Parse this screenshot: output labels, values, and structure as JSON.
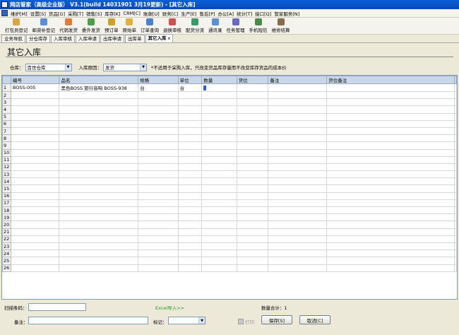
{
  "window": {
    "title": "网店管家（高级企业版） V3.1(build 14031901 3月19更新) - [其它入库]"
  },
  "menu": [
    "维护[M]",
    "设置[S]",
    "货品[G]",
    "采购[T]",
    "销售[S]",
    "库存[K]",
    "CRM[C]",
    "账款[U]",
    "财务[C]",
    "生产[E]",
    "售后[P]",
    "办公[A]",
    "统计[T]",
    "接口[Q]",
    "管家服务[N]"
  ],
  "toolbar": [
    {
      "label": "打包员登记",
      "color": "#d9a441"
    },
    {
      "label": "邮资补登记",
      "color": "#5a8fd6"
    },
    {
      "label": "代销发货",
      "color": "#e07b39"
    },
    {
      "label": "委外发货",
      "color": "#4aa04a"
    },
    {
      "label": "预订单",
      "color": "#c9a227"
    },
    {
      "label": "原始单",
      "color": "#e0b040"
    },
    {
      "label": "订单查询",
      "color": "#4f7fd0"
    },
    {
      "label": "退换审核",
      "color": "#d05050"
    },
    {
      "label": "配货分流",
      "color": "#3a9a6a"
    },
    {
      "label": "通讯录",
      "color": "#5a8fd6"
    },
    {
      "label": "任务管理",
      "color": "#6a6ac0"
    },
    {
      "label": "手机短信",
      "color": "#4a8a4a"
    },
    {
      "label": "维修结算",
      "color": "#8a6a4a"
    }
  ],
  "tabs": [
    {
      "label": "业务导航",
      "active": false
    },
    {
      "label": "分仓库存",
      "active": false
    },
    {
      "label": "入库审核",
      "active": false
    },
    {
      "label": "入库申请",
      "active": false
    },
    {
      "label": "出库申请",
      "active": false
    },
    {
      "label": "出库单",
      "active": false
    },
    {
      "label": "其它入库",
      "active": true,
      "close": "x"
    }
  ],
  "page": {
    "title": "其它入库"
  },
  "filters": {
    "warehouse_label": "仓库：",
    "warehouse_value": "百世仓库",
    "reason_label": "入库原因：",
    "reason_value": "发货",
    "note": "*不适用于采购入库，只改变货品库存量而不改变库存货品的成本价"
  },
  "grid": {
    "columns": [
      "编号",
      "品名",
      "规格",
      "单位",
      "数量",
      "货位",
      "备注",
      "货位备注"
    ],
    "rows": [
      [
        "BOSS-005",
        "黑色BOSS 旅行音响 BOSS-938",
        "台",
        "台",
        "",
        "",
        "",
        ""
      ]
    ],
    "row_numbers": [
      "1",
      "2",
      "3",
      "4",
      "5",
      "6",
      "7",
      "8",
      "9",
      "10",
      "11",
      "12",
      "13",
      "14",
      "15",
      "16",
      "17",
      "18",
      "19",
      "20",
      "21",
      "22",
      "23",
      "24",
      "25",
      "26"
    ]
  },
  "bottom": {
    "scan_label": "扫描条码：",
    "excel_link": "Excel导入>>",
    "total_label": "数量合计：1",
    "remark_label": "备注：",
    "mark_label": "标记：",
    "print_label": "打印",
    "save_label": "保存[S]",
    "cancel_label": "取消[C]"
  }
}
